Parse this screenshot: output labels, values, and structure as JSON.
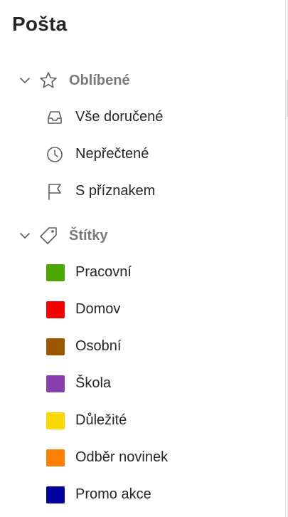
{
  "title": "Pošta",
  "favorites": {
    "label": "Oblíbené",
    "icon": "star-icon",
    "items": [
      {
        "label": "Vše doručené",
        "icon": "inbox-icon"
      },
      {
        "label": "Nepřečtené",
        "icon": "clock-icon"
      },
      {
        "label": "S příznakem",
        "icon": "flag-icon"
      }
    ]
  },
  "tags": {
    "label": "Štítky",
    "icon": "tag-icon",
    "items": [
      {
        "label": "Pracovní",
        "color": "#4CA600"
      },
      {
        "label": "Domov",
        "color": "#F70000"
      },
      {
        "label": "Osobní",
        "color": "#9C5700"
      },
      {
        "label": "Škola",
        "color": "#8A3FAF"
      },
      {
        "label": "Důležité",
        "color": "#F8D800"
      },
      {
        "label": "Odběr novinek",
        "color": "#FF7F00"
      },
      {
        "label": "Promo akce",
        "color": "#0000A0"
      }
    ]
  }
}
